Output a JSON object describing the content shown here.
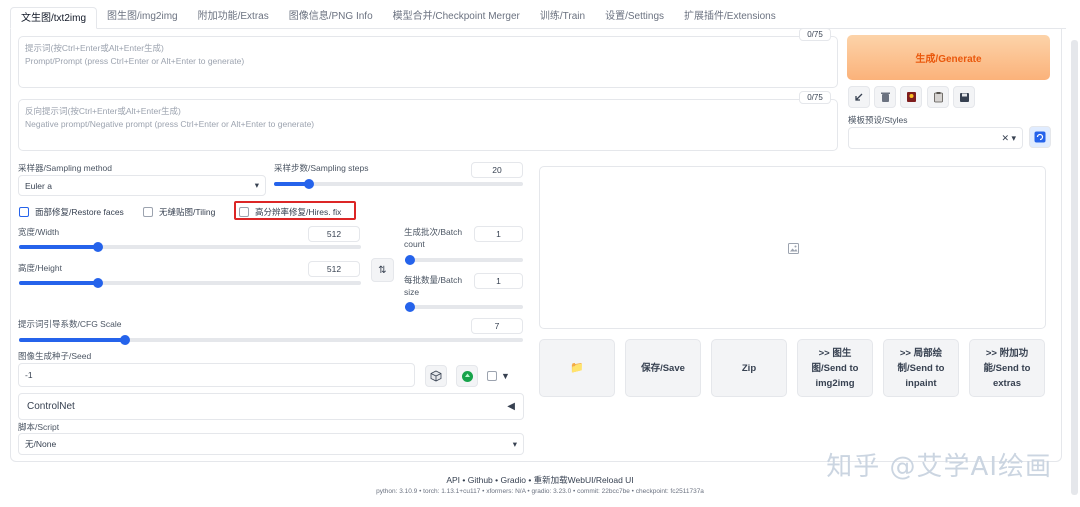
{
  "tabs": [
    {
      "label": "文生图/txt2img",
      "active": true
    },
    {
      "label": "图生图/img2img"
    },
    {
      "label": "附加功能/Extras"
    },
    {
      "label": "图像信息/PNG Info"
    },
    {
      "label": "模型合并/Checkpoint Merger"
    },
    {
      "label": "训练/Train"
    },
    {
      "label": "设置/Settings"
    },
    {
      "label": "扩展插件/Extensions"
    }
  ],
  "prompt": {
    "placeholder_line1": "提示词(按Ctrl+Enter或Alt+Enter生成)",
    "placeholder_line2": "Prompt/Prompt (press Ctrl+Enter or Alt+Enter to generate)",
    "counter": "0/75"
  },
  "negative_prompt": {
    "placeholder_line1": "反向提示词(按Ctrl+Enter或Alt+Enter生成)",
    "placeholder_line2": "Negative prompt/Negative prompt (press Ctrl+Enter or Alt+Enter to generate)",
    "counter": "0/75"
  },
  "generate_label": "生成/Generate",
  "tool_icons": [
    "arrow-icon",
    "trash-icon",
    "card-icon",
    "clipboard-icon",
    "save-icon"
  ],
  "styles": {
    "label": "模板预设/Styles",
    "value": ""
  },
  "sampler": {
    "label": "采样器/Sampling method",
    "value": "Euler a"
  },
  "steps": {
    "label": "采样步数/Sampling steps",
    "value": "20",
    "level": 0.14
  },
  "checks": {
    "restore_faces": "面部修复/Restore faces",
    "tiling": "无缝贴图/Tiling",
    "hires_fix": "高分辨率修复/Hires. fix"
  },
  "width": {
    "label": "宽度/Width",
    "value": "512",
    "level": 0.23
  },
  "height": {
    "label": "高度/Height",
    "value": "512",
    "level": 0.23
  },
  "batch_count": {
    "label_line1": "生成批次/Batch",
    "label_line2": "count",
    "value": "1",
    "level": 0.0
  },
  "batch_size": {
    "label_line1": "每批数量/Batch",
    "label_line2": "size",
    "value": "1",
    "level": 0.0
  },
  "cfg": {
    "label": "提示词引导系数/CFG Scale",
    "value": "7",
    "level": 0.21
  },
  "seed": {
    "label": "图像生成种子/Seed",
    "value": "-1"
  },
  "controlnet": {
    "label": "ControlNet",
    "arrow": "◀"
  },
  "script": {
    "label": "脚本/Script",
    "value": "无/None"
  },
  "actions": {
    "folder": "📁",
    "save": "保存/Save",
    "zip": "Zip",
    "send_img2img": [
      ">> 图生",
      "图/Send to",
      "img2img"
    ],
    "send_inpaint": [
      ">> 局部绘",
      "制/Send to",
      "inpaint"
    ],
    "send_extras": [
      ">> 附加功",
      "能/Send to",
      "extras"
    ]
  },
  "footer": {
    "links": "API  •  Github  •  Gradio  •  重新加载WebUI/Reload UI",
    "versions": "python: 3.10.9  •  torch: 1.13.1+cu117  •  xformers: N/A  •  gradio: 3.23.0  •  commit: 22bcc7be  •  checkpoint: fc2511737a"
  },
  "watermark": "知乎 @艾学AI绘画",
  "colors": {
    "accent": "#2563eb",
    "generate_text": "#ea580c",
    "highlight": "#dc2626"
  }
}
